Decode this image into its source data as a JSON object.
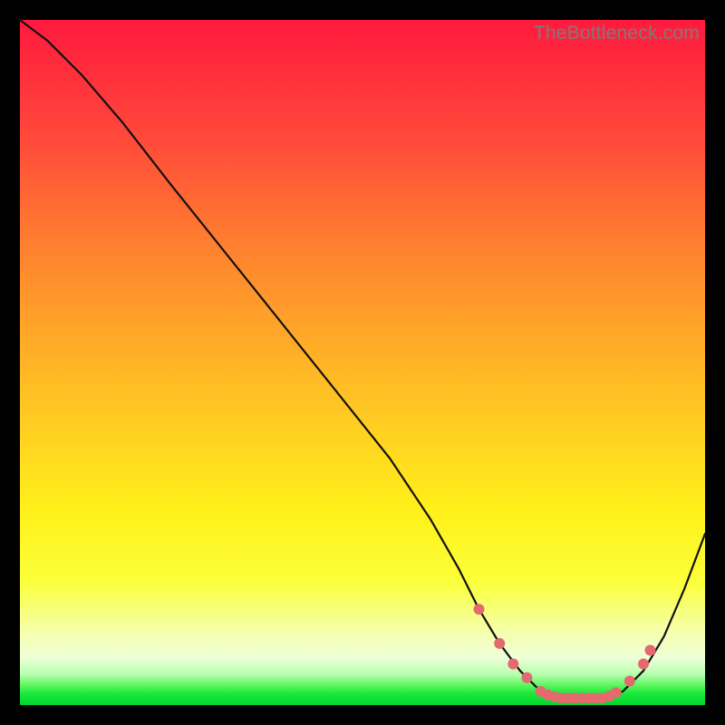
{
  "watermark": "TheBottleneck.com",
  "colors": {
    "background": "#000000",
    "gradient_top": "#ff1a3e",
    "gradient_mid": "#fff11a",
    "gradient_bottom": "#00d62e",
    "curve": "#111111",
    "marker": "#e46a6f"
  },
  "chart_data": {
    "type": "line",
    "title": "",
    "xlabel": "",
    "ylabel": "",
    "xlim": [
      0,
      100
    ],
    "ylim": [
      0,
      100
    ],
    "note": "No axis ticks or labels are rendered in the image; x is normalized 0–100 left→right, y is normalized 0–100 bottom→top, values estimated from pixel position.",
    "series": [
      {
        "name": "curve",
        "x": [
          0,
          4,
          9,
          15,
          22,
          30,
          38,
          46,
          54,
          60,
          64,
          67,
          70,
          73,
          76,
          79,
          82,
          85,
          88,
          91,
          94,
          97,
          100
        ],
        "y": [
          100,
          97,
          92,
          85,
          76,
          66,
          56,
          46,
          36,
          27,
          20,
          14,
          9,
          5,
          2,
          1,
          1,
          1,
          2,
          5,
          10,
          17,
          25
        ]
      }
    ],
    "markers": {
      "comment": "Salmon dots along the valley segment of the curve",
      "x": [
        67,
        70,
        72,
        74,
        76,
        77,
        78,
        79,
        80,
        81,
        82,
        83,
        84,
        85,
        86,
        87,
        89,
        91,
        92
      ],
      "y": [
        14,
        9,
        6,
        4,
        2,
        1.5,
        1.2,
        1,
        1,
        1,
        1,
        1,
        1,
        1,
        1.3,
        1.8,
        3.5,
        6,
        8
      ]
    }
  }
}
